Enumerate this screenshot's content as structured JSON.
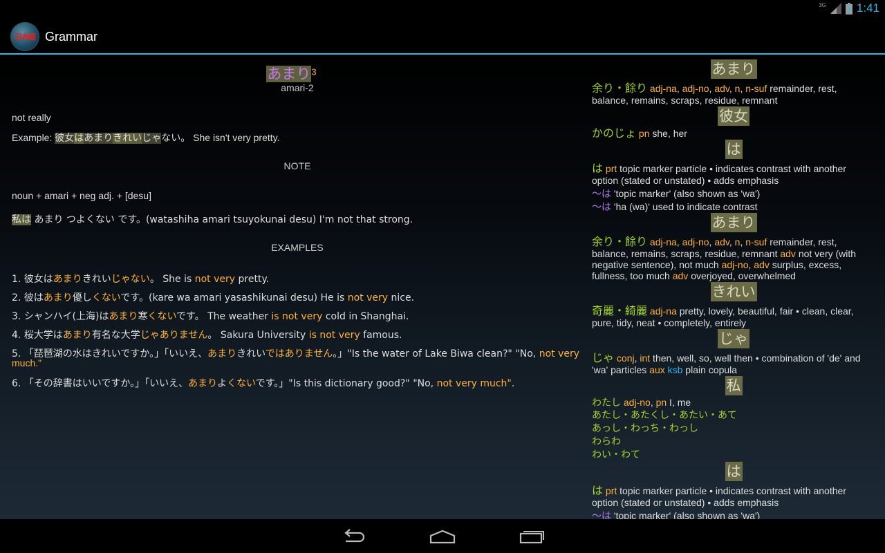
{
  "status": {
    "network": "3G",
    "time": "1:41"
  },
  "app": {
    "title": "Grammar"
  },
  "entry": {
    "headword": "あまり",
    "superscript": "3",
    "romaji": "amari-2",
    "meaning": "not really",
    "example_label": "Example:",
    "example_parts": [
      "彼女",
      "は",
      "あまり",
      "きれい",
      "じゃ",
      "ない。"
    ],
    "example_en": "She isn't very pretty.",
    "note_heading": "NOTE",
    "pattern": "noun + amari + neg adj. + [desu]",
    "note_ex_hl": "私は",
    "note_ex_rest": " あまり つよくない です。(watashiha amari tsuyokunai desu) I'm not that strong.",
    "examples_heading": "EXAMPLES",
    "examples": [
      {
        "a": "1. 彼女は",
        "b": "あまり",
        "c": "きれい",
        "d": "じゃない",
        "e": "。 She is ",
        "f": "not very",
        "g": " pretty."
      },
      {
        "a": "2. 彼は",
        "b": "あまり",
        "c": "優し",
        "d": "くない",
        "e": "です。(kare wa amari yasashikunai desu) He is ",
        "f": "not very",
        "g": " nice."
      },
      {
        "a": "3. シャンハイ(上海)は",
        "b": "あまり",
        "c": "寒",
        "d": "くない",
        "e": "です。 The weather ",
        "f": "is not very",
        "g": " cold in Shanghai."
      },
      {
        "a": "4. 桜大学は",
        "b": "あまり",
        "c": "有名な大学",
        "d": "じゃありません",
        "e": "。 Sakura University ",
        "f": "is not very",
        "g": " famous."
      }
    ],
    "ex5_line1_a": "5. 「琵琶湖の水はきれいですか。」「いいえ、",
    "ex5_line1_b": "あまり",
    "ex5_line1_c": "きれい",
    "ex5_line1_d": "ではありません",
    "ex5_line1_e": "。」\"Is the water of Lake Biwa clean?\" \"No, ",
    "ex5_line1_f": "not very",
    "ex5_line2": "much.\"",
    "ex6_a": "6. 「その辞書はいいですか。」「いいえ、",
    "ex6_b": "あまり",
    "ex6_c": "よ",
    "ex6_d": "くない",
    "ex6_e": "です。」\"Is this dictionary good?\" \"No, ",
    "ex6_f": "not very much\"",
    "ex6_g": "."
  },
  "dictionary": {
    "h1": "あまり",
    "e1_word": "余り・餘り",
    "e1_pos": [
      "adj-na",
      "adj-no",
      "adv",
      "n",
      "n-suf"
    ],
    "e1_def_l1": " remainder, rest,",
    "e1_def_l2": "balance, remains, scraps, residue, remnant",
    "h2": "彼女",
    "e2_word": "かのじょ",
    "e2_pos": "pn",
    "e2_def": " she, her",
    "h3": "は",
    "e3_word": "は",
    "e3_pos": "prt",
    "e3_def_l1": " topic marker particle • indicates contrast with another",
    "e3_def_l2": "option (stated or unstated) • adds emphasis",
    "e3_sub1_mark": "〜は",
    "e3_sub1": " 'topic marker' (also shown as 'wa')",
    "e3_sub2_mark": "〜は",
    "e3_sub2": " 'ha (wa)' used to indicate contrast",
    "h4": "あまり",
    "e4_word": "余り・餘り",
    "e4_def_l1": " remainder, rest,",
    "e4_def_l2a": "balance, remains, scraps, residue, remnant ",
    "e4_adv1": "adv",
    "e4_def_l2b": " not very (with",
    "e4_def_l3a": "negative sentence), not much ",
    "e4_pos3a": "adj-no",
    "e4_pos3b": "adv",
    "e4_def_l3b": " surplus, excess,",
    "e4_def_l4a": "fullness, too much ",
    "e4_adv2": "adv",
    "e4_def_l4b": " overjoyed, overwhelmed",
    "h5": "きれい",
    "e5_word": "奇麗・綺麗",
    "e5_pos": "adj-na",
    "e5_def_l1": " pretty, lovely, beautiful, fair • clean, clear,",
    "e5_def_l2": "pure, tidy, neat • completely, entirely",
    "h6": "じゃ",
    "e6_word": "じゃ",
    "e6_pos": [
      "conj",
      "int"
    ],
    "e6_def_l1": " then, well, so, well then • combination of 'de' and",
    "e6_def_l2a": "'wa' particles ",
    "e6_aux": "aux",
    "e6_ksb": "ksb",
    "e6_def_l2b": " plain copula",
    "h7": "私",
    "e7_word": "わたし",
    "e7_pos": [
      "adj-no",
      "pn"
    ],
    "e7_def": " I, me",
    "e7_alt1": "あたし・あたくし・あたい・あて",
    "e7_alt2": "あっし・わっち・わっし",
    "e7_alt3": "わらわ",
    "e7_alt4": "わい・わて",
    "h8": "は",
    "e8_word": "は",
    "e8_pos": "prt",
    "e8_def_l1": " topic marker particle • indicates contrast with another",
    "e8_def_l2": "option (stated or unstated) • adds emphasis",
    "e8_sub1_mark": "〜は",
    "e8_sub1": " 'topic marker' (also shown as 'wa')"
  },
  "nav": {
    "back": "back-icon",
    "home": "home-icon",
    "recents": "recents-icon"
  }
}
